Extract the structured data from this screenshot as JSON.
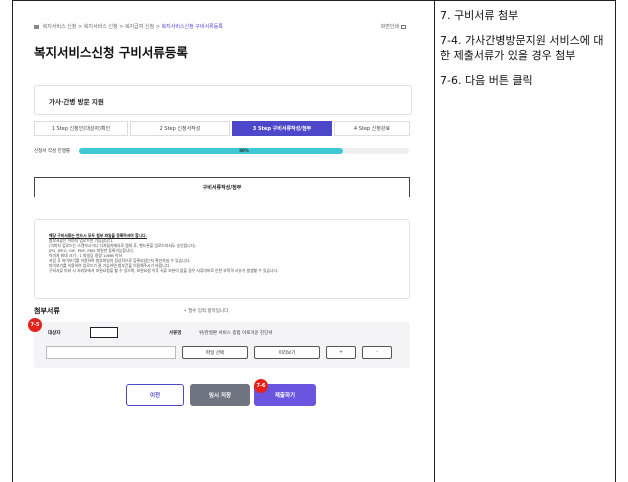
{
  "breadcrumb": [
    "복지서비스 신청",
    "복지서비스 신청",
    "복지급여 신청",
    "복지서비스신청 구비서류등록"
  ],
  "print_label": "화면인쇄",
  "page_title": "복지서비스신청 구비서류등록",
  "service_name": "가사·간병 방문 지원",
  "steps": [
    "1 Step 신청인(대상자)확인",
    "2 Step 신청서작성",
    "3 Step 구비서류작성/첨부",
    "4 Step 신청완료"
  ],
  "progress": {
    "label": "신청서 작성 진행률",
    "percent_text": "80%",
    "value": 0.8
  },
  "tab_label": "구비서류작성/첨부",
  "notice": [
    "해당 구비서류는 반드시 모두 첨부 파일을 등록하셔야 합니다.",
    "첨부서류는 이미지 업로드만 가능합니다.",
    "  (이미지 업로드는 스캔하시거나 디지털카메라로 캡쳐 후, 핸드폰을 업로드하셔도 승인됩니다)",
    "JPG, JPEG, GIF, PDF, PNG 파일만 등록가능합니다.",
    "이미지 최대 크기 : 1 파일당 용량 10MB 이하",
    "저장 후 마이보기를 이용하여 첨부파일의 정상적으로 등록되었는지 확인하실 수 있습니다.",
    "마이보기를 이용하여 업로드가 잘 가능하면 첨부건을 이용해주시기 바랍니다.",
    "구비서류 미비 시 처리부에서 보완요청을 할 수 있으며, 보완요청 이후 서류 보완이 없을 경우 서류미비로 인한 부적격 사유가 발생할 수 있습니다."
  ],
  "attach": {
    "title": "첨부서류",
    "note": "• 필수 입력 항목입니다.",
    "target_label": "대상자",
    "docname_label": "서류명",
    "docname_value": "위/관절환 서비스 종합 아로거운 진단서",
    "btn_select": "파일 선택",
    "btn_view": "미리보기",
    "btn_plus": "+",
    "btn_minus": "-"
  },
  "buttons": {
    "prev": "이전",
    "temp_save": "임시 저장",
    "submit": "제출하기"
  },
  "markers": {
    "m1": "7-5",
    "m2": "7-6"
  },
  "instructions": [
    "7. 구비서류 첨부",
    "7-4. 가사간병방문지원 서비스에 대한 제출서류가 있을 경우 첨부",
    "7-6. 다음 버튼 클릭"
  ],
  "colors": {
    "accent": "#4d48c9",
    "progress": "#3ec8d6",
    "marker": "#e5221a",
    "submit": "#6a55e0"
  }
}
